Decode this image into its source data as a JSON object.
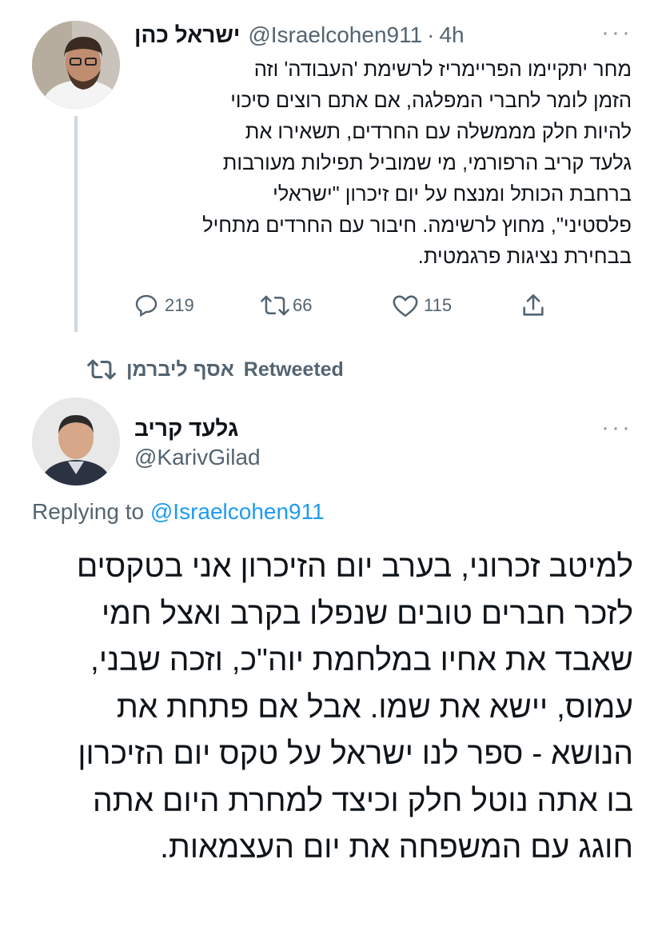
{
  "tweet1": {
    "name": "ישראל כהן",
    "handle": "@Israelcohen911",
    "separator": "·",
    "time": "4h",
    "more": "···",
    "lines": [
      "מחר יתקיימו הפריימריז לרשימת 'העבודה' וזה",
      "הזמן לומר לחברי המפלגה, אם אתם רוצים סיכוי",
      "להיות חלק מממשלה עם החרדים, תשאירו את",
      "גלעד קריב הרפורמי, מי שמוביל תפילות מעורבות",
      "ברחבת הכותל ומנצח על יום זיכרון \"ישראלי",
      "פלסטיני\", מחוץ לרשימה. חיבור עם החרדים מתחיל",
      "בבחירת נציגות פרגמטית."
    ],
    "actions": {
      "replies": "219",
      "retweets": "66",
      "likes": "115"
    },
    "icons": [
      "reply-icon",
      "retweet-icon",
      "like-icon",
      "share-icon"
    ]
  },
  "retweet_banner": {
    "retweeter": "אסף ליברמן",
    "label": "Retweeted"
  },
  "tweet2": {
    "name": "גלעד קריב",
    "handle": "@KarivGilad",
    "more": "···",
    "replying_prefix": "Replying to",
    "replying_handle": "@Israelcohen911",
    "lines": [
      "למיטב זכרוני, בערב יום הזיכרון אני בטקסים",
      "לזכר חברים טובים שנפלו בקרב ואצל חמי",
      "שאבד את אחיו במלחמת יוה\"כ, וזכה שבני,",
      "עמוס, יישא את שמו. אבל אם פתחת את",
      "הנושא - ספר לנו ישראל על טקס יום הזיכרון",
      "בו אתה נוטל חלק וכיצד למחרת היום אתה",
      "חוגג עם המשפחה את יום העצמאות."
    ]
  },
  "colors": {
    "link": "#1d9bf0",
    "secondary": "#536471",
    "thread_line": "#cfd9de",
    "text": "#0f1419"
  }
}
